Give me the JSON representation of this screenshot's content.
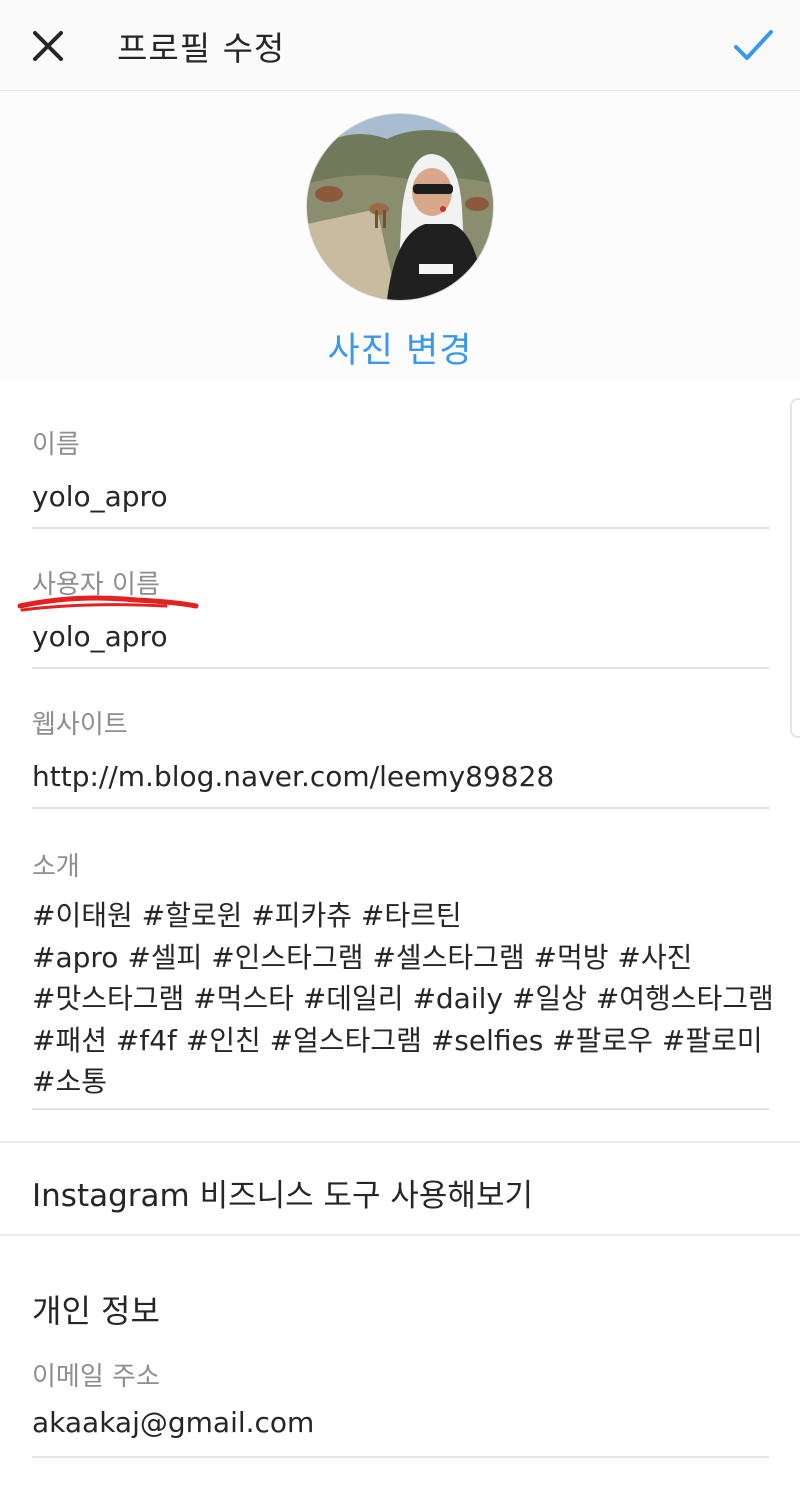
{
  "header": {
    "title": "프로필 수정",
    "close_icon": "close-icon",
    "confirm_icon": "check-icon",
    "accent_color": "#3897f0"
  },
  "profile_photo": {
    "change_label": "사진 변경"
  },
  "fields": {
    "name": {
      "label": "이름",
      "value": "yolo_apro"
    },
    "username": {
      "label": "사용자 이름",
      "value": "yolo_apro"
    },
    "website": {
      "label": "웹사이트",
      "value": "http://m.blog.naver.com/leemy89828"
    },
    "bio": {
      "label": "소개",
      "lines": [
        "#이태원 #할로윈 #피카츄 #타르틴",
        "#apro #셀피 #인스타그램 #셀스타그램 #먹방 #사진",
        "#맛스타그램 #먹스타 #데일리 #daily #일상 #여행스타그램",
        "#패션 #f4f #인친 #얼스타그램 #selfies #팔로우 #팔로미",
        "#소통"
      ]
    }
  },
  "business": {
    "label": "Instagram 비즈니스 도구 사용해보기"
  },
  "private_info": {
    "title": "개인 정보",
    "email": {
      "label": "이메일 주소",
      "value": "akaakaj@gmail.com"
    }
  }
}
